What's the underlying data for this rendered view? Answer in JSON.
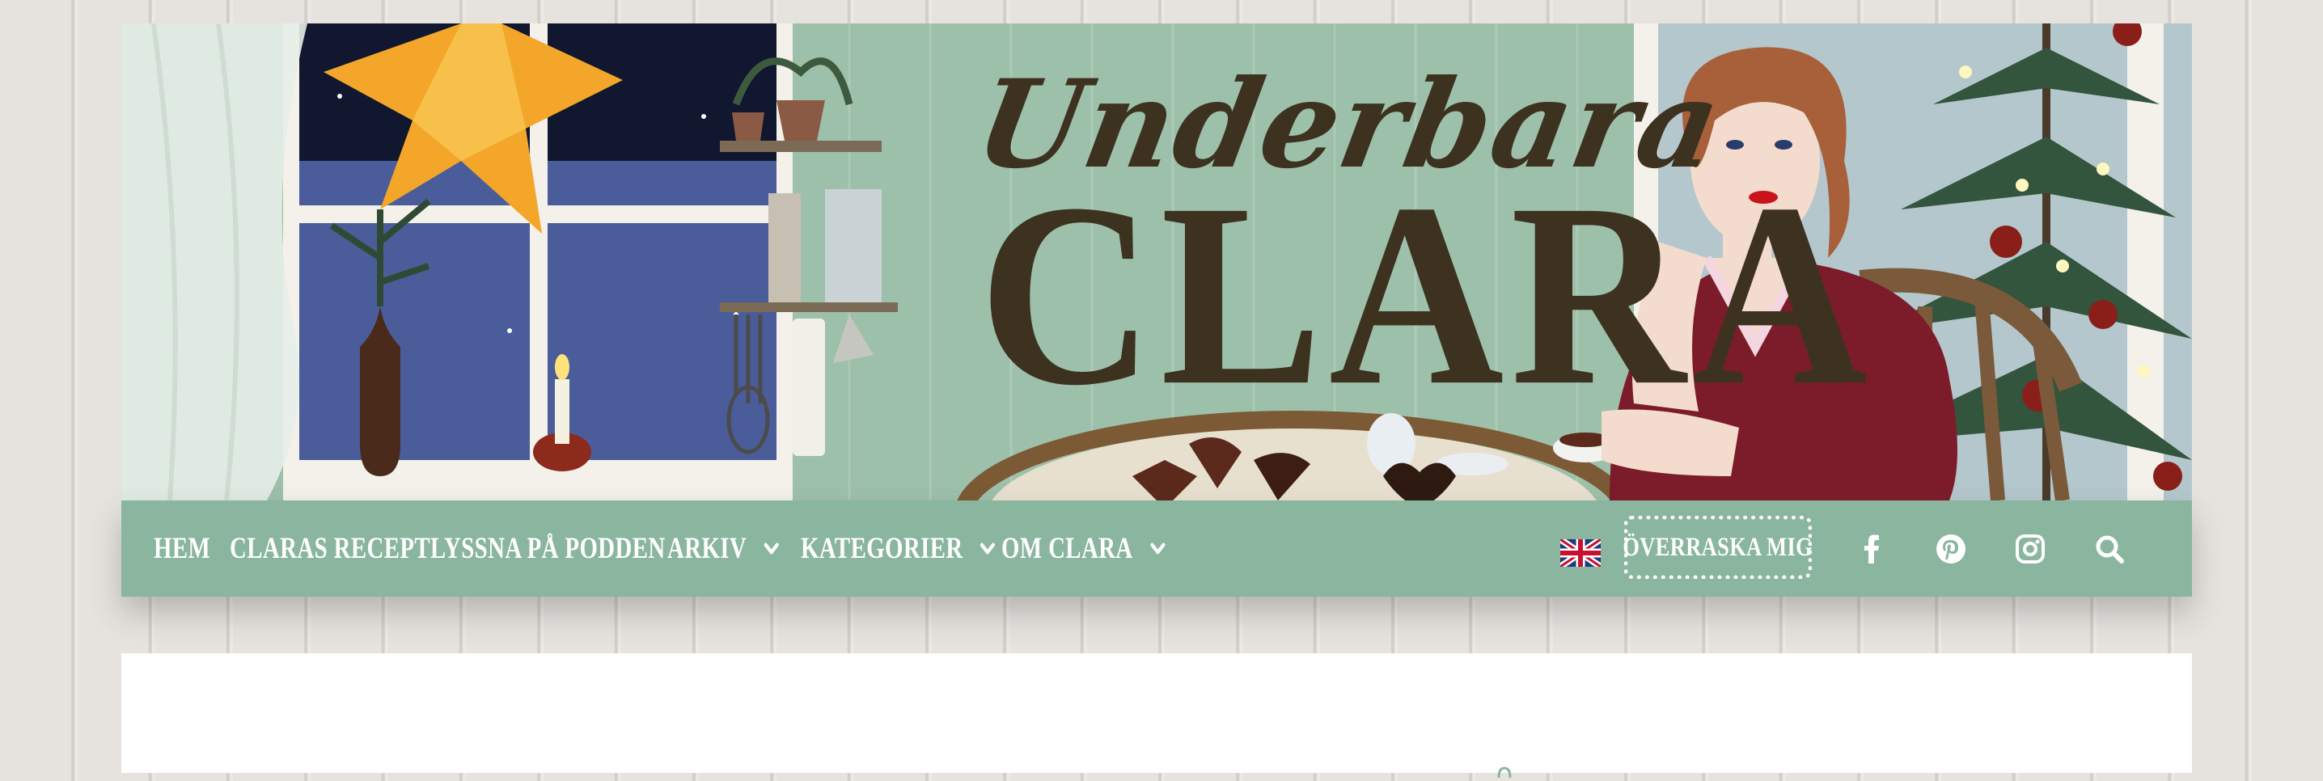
{
  "header": {
    "title_script": "Underbara",
    "title_main": "CLARA"
  },
  "nav": {
    "items": [
      {
        "label": "HEM",
        "has_dropdown": false
      },
      {
        "label": "CLARAS RECEPT",
        "has_dropdown": false
      },
      {
        "label": "LYSSNA PÅ PODDEN",
        "has_dropdown": false
      },
      {
        "label": "ARKIV",
        "has_dropdown": true
      },
      {
        "label": "KATEGORIER",
        "has_dropdown": true
      },
      {
        "label": "OM CLARA",
        "has_dropdown": true
      }
    ],
    "language_icon": "uk-flag-icon",
    "surprise_label": "ÖVERRASKA MIG",
    "social_icons": [
      "facebook-icon",
      "pinterest-icon",
      "instagram-icon",
      "search-icon"
    ]
  },
  "colors": {
    "nav_background": "#8ab59e",
    "nav_text": "#ffffff",
    "banner_background": "#9dc0aa",
    "title_color": "#3d3220",
    "page_background": "#e6e3df"
  }
}
